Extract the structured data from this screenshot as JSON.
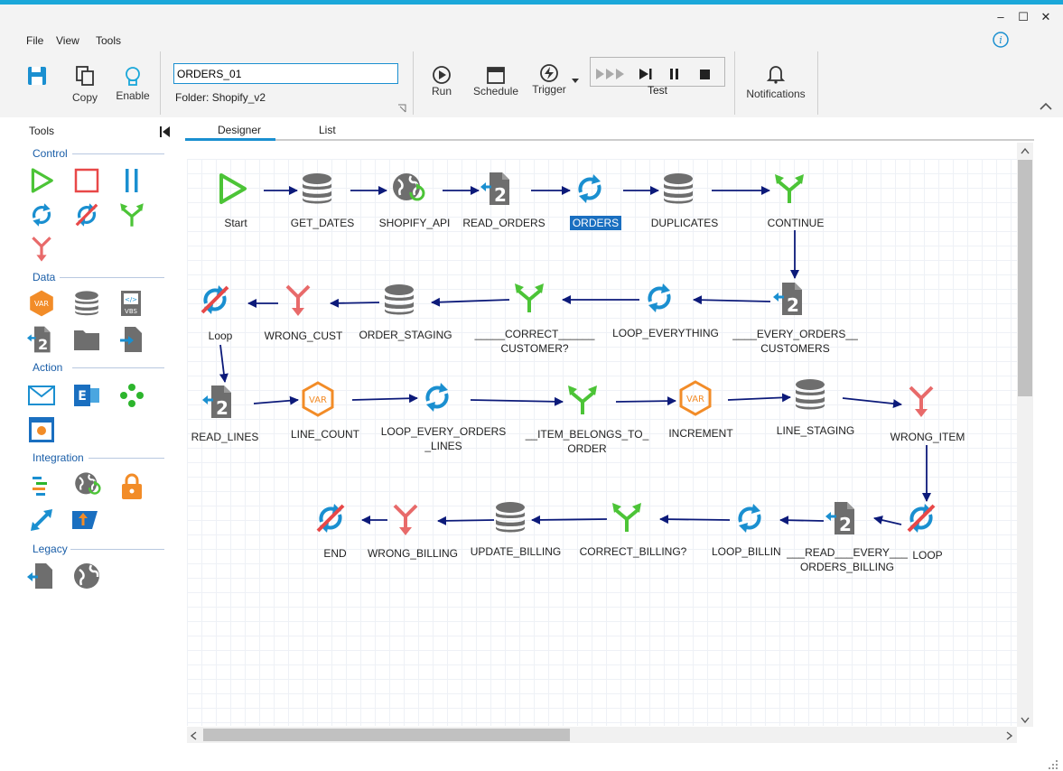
{
  "menu": {
    "file": "File",
    "view": "View",
    "tools": "Tools"
  },
  "ribbon": {
    "copy": "Copy",
    "enable": "Enable",
    "name_value": "ORDERS_01",
    "folder_label": "Folder:",
    "folder_value": "Shopify_v2",
    "run": "Run",
    "schedule": "Schedule",
    "trigger": "Trigger",
    "test": "Test",
    "notifications": "Notifications"
  },
  "tools": {
    "title": "Tools",
    "sections": {
      "control": "Control",
      "data": "Data",
      "action": "Action",
      "integration": "Integration",
      "legacy": "Legacy"
    }
  },
  "tabs": {
    "designer": "Designer",
    "list": "List"
  },
  "nodes": {
    "start": "Start",
    "get_dates": "GET_DATES",
    "shopify_api": "SHOPIFY_API",
    "read_orders": "READ_ORDERS",
    "orders": "ORDERS",
    "duplicates": "DUPLICATES",
    "continue": "CONTINUE",
    "every_orders_1": "____EVERY_ORDERS__",
    "every_orders_2": "CUSTOMERS",
    "loop_everything": "LOOP_EVERYTHING",
    "correct_cust_1": "_____CORRECT______",
    "correct_cust_2": "CUSTOMER?",
    "order_staging": "ORDER_STAGING",
    "wrong_cust": "WRONG_CUST",
    "loop1": "Loop",
    "read_lines": "READ_LINES",
    "line_count": "LINE_COUNT",
    "loop_lines_1": "LOOP_EVERY_ORDERS",
    "loop_lines_2": "_LINES",
    "item_belongs_1": "__ITEM_BELONGS_TO_",
    "item_belongs_2": "ORDER",
    "increment": "INCREMENT",
    "line_staging": "LINE_STAGING",
    "wrong_item": "WRONG_ITEM",
    "loop2": "LOOP",
    "read_billing_1": "___READ___EVERY___",
    "read_billing_2": "ORDERS_BILLING",
    "loop_billing": "LOOP_BILLIN",
    "correct_billing": "CORRECT_BILLING?",
    "update_billing": "UPDATE_BILLING",
    "wrong_billing": "WRONG_BILLING",
    "end": "END"
  },
  "colors": {
    "accent": "#1a8fd0",
    "green": "#4cc437",
    "red": "#e84848",
    "orange": "#f28c28",
    "db": "#6e6e6e",
    "arrow": "#0c1a7a"
  }
}
